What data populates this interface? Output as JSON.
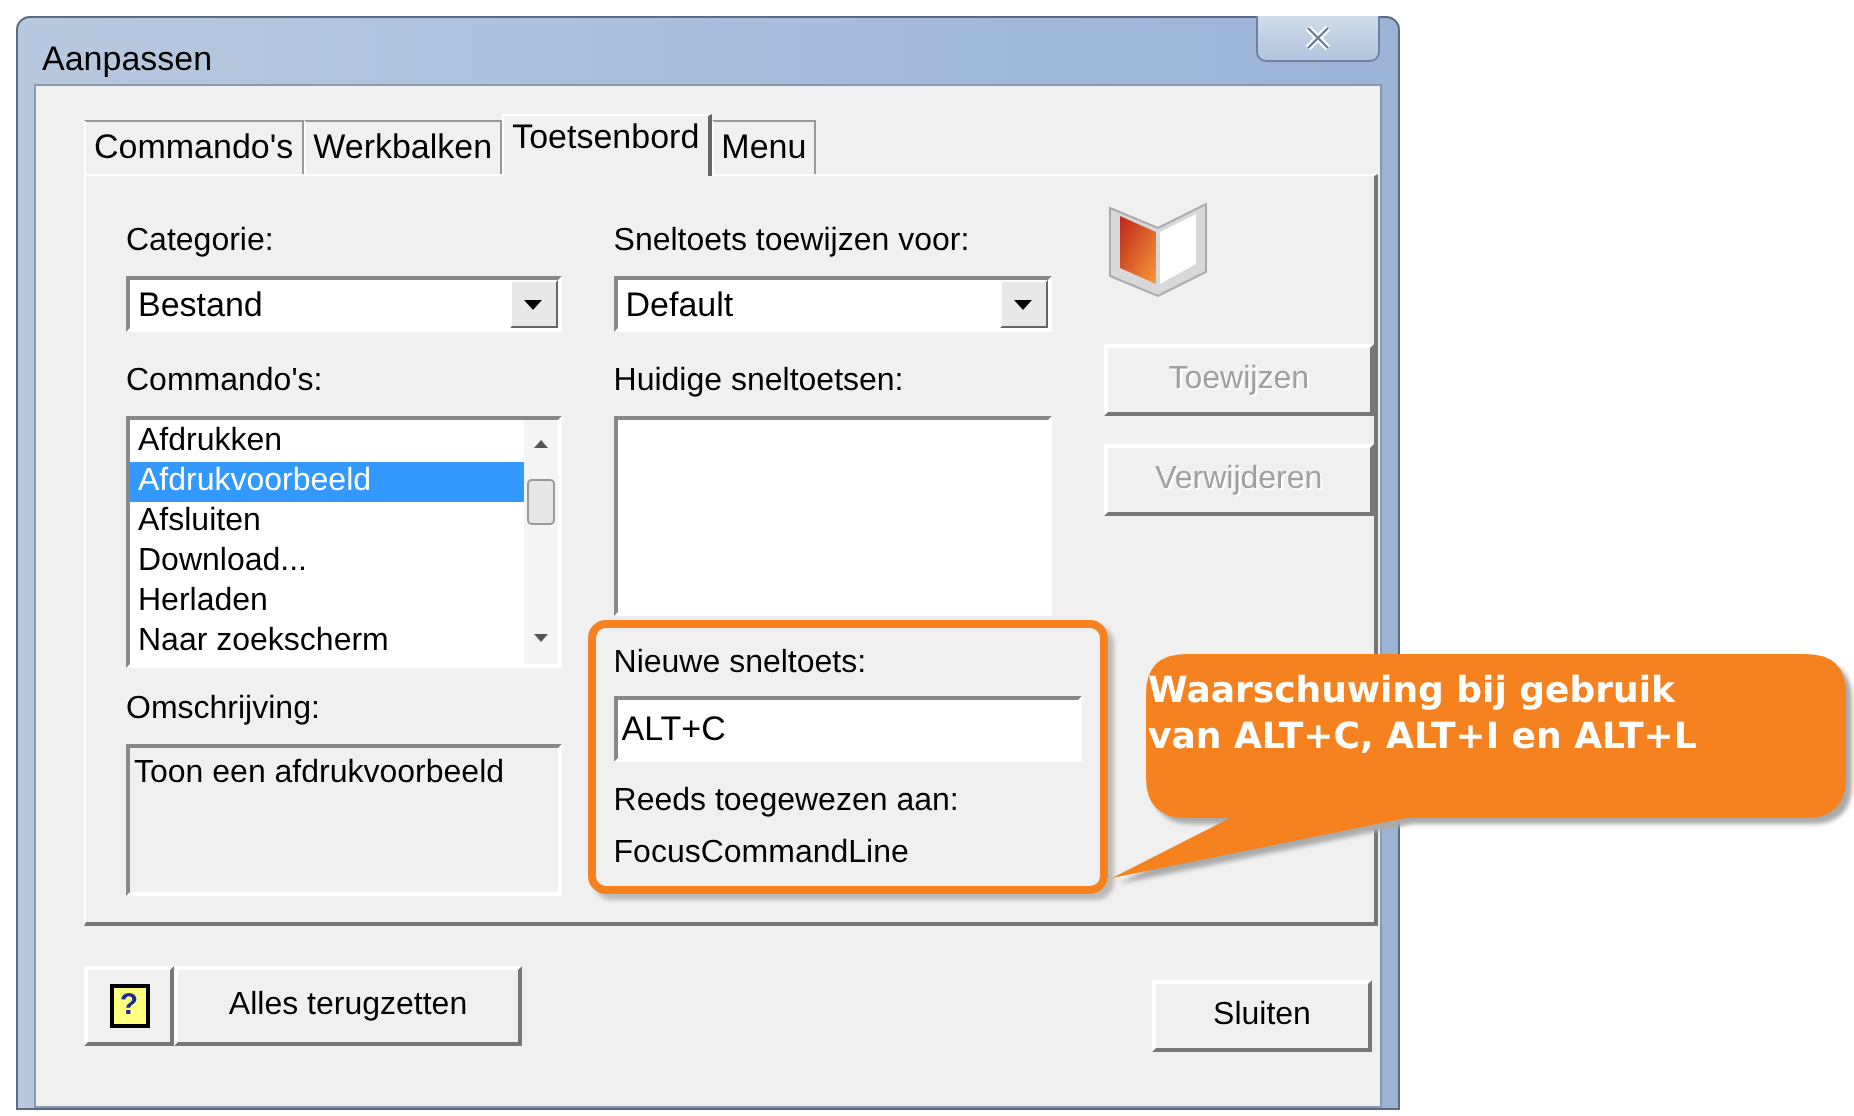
{
  "window": {
    "title": "Aanpassen"
  },
  "tabs": [
    {
      "label": "Commando's",
      "selected": false
    },
    {
      "label": "Werkbalken",
      "selected": false
    },
    {
      "label": "Toetsenbord",
      "selected": true
    },
    {
      "label": "Menu",
      "selected": false
    }
  ],
  "category": {
    "label": "Categorie:",
    "value": "Bestand"
  },
  "commands": {
    "label": "Commando's:",
    "items": [
      {
        "label": "Afdrukken",
        "selected": false
      },
      {
        "label": "Afdrukvoorbeeld",
        "selected": true
      },
      {
        "label": "Afsluiten",
        "selected": false
      },
      {
        "label": "Download...",
        "selected": false
      },
      {
        "label": "Herladen",
        "selected": false
      },
      {
        "label": "Naar zoekscherm",
        "selected": false
      }
    ]
  },
  "description": {
    "label": "Omschrijving:",
    "text": "Toon een afdrukvoorbeeld"
  },
  "assign_for": {
    "label": "Sneltoets toewijzen voor:",
    "value": "Default"
  },
  "current_shortcuts": {
    "label": "Huidige sneltoetsen:"
  },
  "side_buttons": [
    {
      "label": "Toewijzen",
      "disabled": true
    },
    {
      "label": "Verwijderen",
      "disabled": true
    }
  ],
  "new_shortcut": {
    "label": "Nieuwe sneltoets:",
    "value": "ALT+C",
    "assigned_label": "Reeds toegewezen aan:",
    "assigned_to": "FocusCommandLine"
  },
  "callout": {
    "lines": [
      "Waarschuwing bij gebruik",
      "van ALT+C, ALT+I en ALT+L"
    ]
  },
  "footer": {
    "help": "?",
    "reset": "Alles terugzetten",
    "close": "Sluiten"
  }
}
